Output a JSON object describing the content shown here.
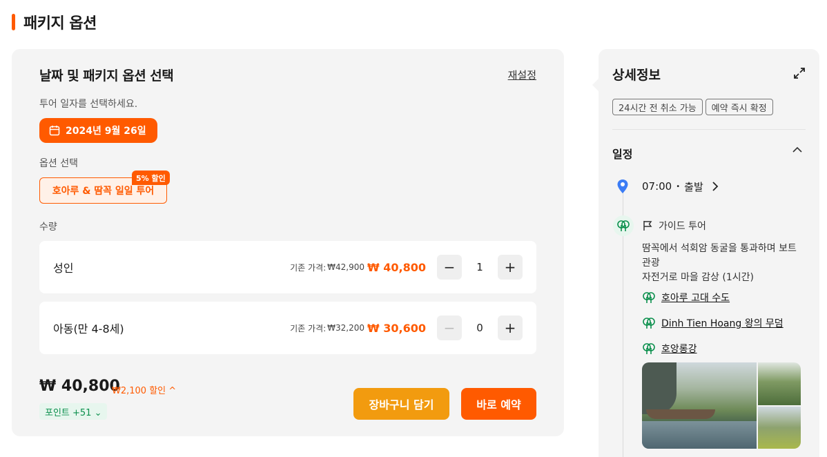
{
  "page": {
    "title": "패키지 옵션"
  },
  "booking": {
    "heading": "날짜 및 패키지 옵션 선택",
    "reset_label": "재설정",
    "date_hint": "투어 일자를 선택하세요.",
    "selected_date": "2024년 9월 26일",
    "option_label": "옵션 선택",
    "option_name": "호아루 & 땀꼭 일일 투어",
    "option_badge": "5% 할인",
    "quantity_label": "수량",
    "rows": [
      {
        "name": "성인",
        "base_label": "기존 가격:",
        "base_price": "₩42,900",
        "sale_price": "₩ 40,800",
        "qty": "1",
        "minus": "−",
        "plus": "+"
      },
      {
        "name": "아동(만 4-8세)",
        "base_label": "기존 가격:",
        "base_price": "₩32,200",
        "sale_price": "₩ 30,600",
        "qty": "0",
        "minus": "−",
        "plus": "+"
      }
    ],
    "total_price": "₩ 40,800",
    "total_discount": "₩2,100 할인 ^",
    "points": "포인트 +51 ⌄",
    "cart_button": "장바구니 담기",
    "book_button": "바로 예약"
  },
  "details": {
    "heading": "상세정보",
    "tags": [
      "24시간 전 취소 가능",
      "예약 즉시 확정"
    ],
    "schedule_title": "일정",
    "departure_time": "07:00",
    "departure_sep": "•",
    "departure_label": "출발",
    "guide_label": "가이드 투어",
    "guide_desc_1": "땀꼭에서 석회암 동굴을 통과하며 보트 관광",
    "guide_desc_2": "자전거로 마을 감상 (1시간)",
    "places": [
      "호아루 고대 수도",
      "Dinh Tien Hoang 왕의 무덤",
      "호앙롱강"
    ]
  },
  "colors": {
    "accent": "#ff5a00",
    "cart": "#f29b0f",
    "point_green": "#0a8f4c",
    "pin_blue": "#3b7cf5"
  },
  "icons": [
    "calendar-icon",
    "expand-icon",
    "chevron-up-icon",
    "location-pin-icon",
    "chevron-right-icon",
    "tree-icon",
    "flag-icon"
  ]
}
